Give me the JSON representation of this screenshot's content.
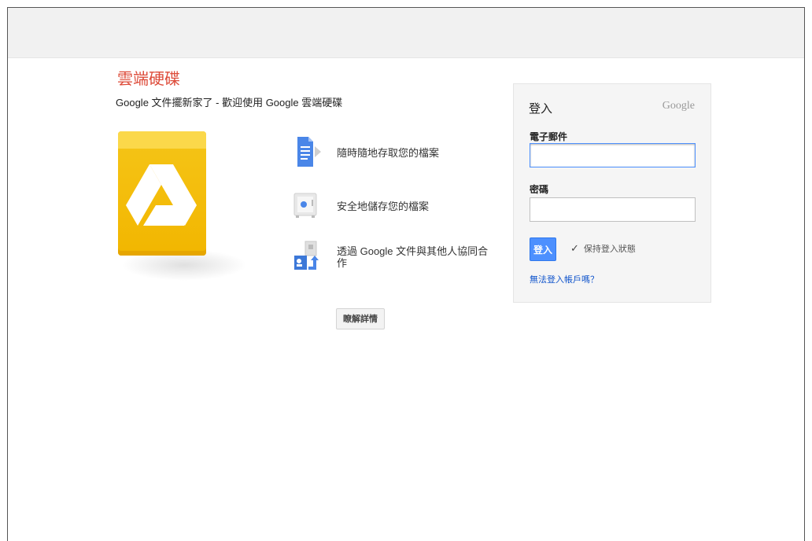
{
  "header": {},
  "brand": {
    "title": "雲端硬碟",
    "subtitle": "Google 文件擺新家了 - 歡迎使用 Google 雲端硬碟"
  },
  "features": [
    {
      "icon": "document-icon",
      "text": "隨時隨地存取您的檔案"
    },
    {
      "icon": "safe-icon",
      "text": "安全地儲存您的檔案"
    },
    {
      "icon": "collaborate-icon",
      "text": "透過 Google 文件與其他人協同合作"
    }
  ],
  "learn_more": "瞭解詳情",
  "signin": {
    "title": "登入",
    "google_word": "Google",
    "email_label": "電子郵件",
    "email_value": "",
    "password_label": "密碼",
    "password_value": "",
    "button": "登入",
    "stay_signed_in": "保持登入狀態",
    "stay_checked": true,
    "help_link": "無法登入帳戶嗎？"
  },
  "colors": {
    "brand_red": "#dd4b39",
    "button_blue": "#4d90fe",
    "link_blue": "#1155cc",
    "drive_yellow": "#f2b600"
  }
}
